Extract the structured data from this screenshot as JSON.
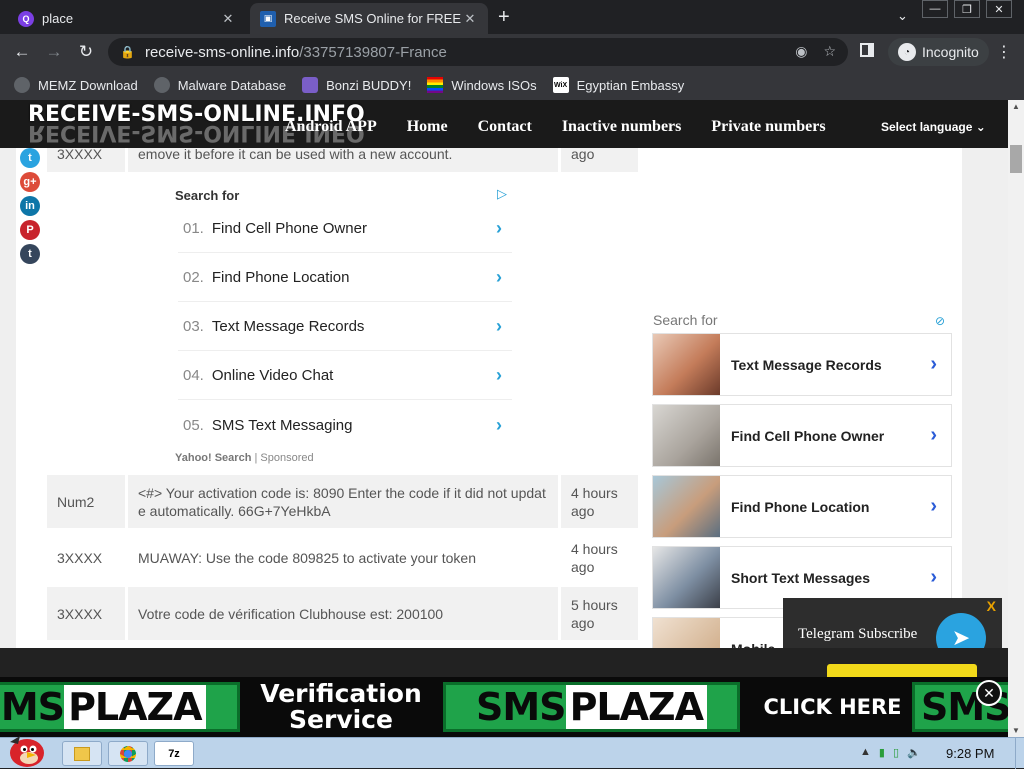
{
  "browser": {
    "tabs": [
      {
        "title": "place",
        "active": false
      },
      {
        "title": "Receive SMS Online for FREE |",
        "active": true
      }
    ],
    "new_tab": "+",
    "url_host": "receive-sms-online.info",
    "url_path": "/33757139807-France",
    "incognito_label": "Incognito",
    "bookmarks": [
      "MEMZ Download",
      "Malware Database",
      "Bonzi BUDDY!",
      "Windows ISOs",
      "Egyptian Embassy"
    ]
  },
  "site": {
    "logo": "RECEIVE-SMS-ONLINE.INFO",
    "nav": [
      "Android APP",
      "Home",
      "Contact",
      "Inactive numbers",
      "Private numbers"
    ],
    "language": "Select language ⌄"
  },
  "messages": {
    "top_row": {
      "from": "3XXXX",
      "text": "emove it before it can be used with a new account.",
      "time": "ago"
    },
    "rows": [
      {
        "from": "Num2",
        "text": "<#> Your activation code is: 8090 Enter the code if it did not updat e automatically. 66G+7YeHkbA",
        "time": "4 hours ago"
      },
      {
        "from": "3XXXX",
        "text": "MUAWAY: Use the code 809825 to activate your token",
        "time": "4 hours ago"
      },
      {
        "from": "3XXXX",
        "text": "Votre code de vérification Clubhouse est: 200100",
        "time": "5 hours ago"
      }
    ]
  },
  "search_ad": {
    "heading": "Search for",
    "items": [
      {
        "n": "01.",
        "label": "Find Cell Phone Owner"
      },
      {
        "n": "02.",
        "label": "Find Phone Location"
      },
      {
        "n": "03.",
        "label": "Text Message Records"
      },
      {
        "n": "04.",
        "label": "Online Video Chat"
      },
      {
        "n": "05.",
        "label": "SMS Text Messaging"
      }
    ],
    "footer_brand": "Yahoo! Search",
    "footer_sep": "|",
    "footer_note": "Sponsored"
  },
  "side_ad": {
    "heading": "Search for",
    "items": [
      "Text Message Records",
      "Find Cell Phone Owner",
      "Find Phone Location",
      "Short Text Messages",
      "Mobile"
    ]
  },
  "telegram": {
    "label": "Telegram Subscribe",
    "close": "X"
  },
  "banner": {
    "brand_a": "SMS",
    "brand_b": "PLAZA",
    "tagline_1": "Verification",
    "tagline_2": "Service",
    "cta": "CLICK HERE",
    "brand_c": "SMS"
  },
  "taskbar": {
    "clock": "9:28 PM",
    "app_label": "7z"
  },
  "colors": {
    "link_blue": "#27a0d6",
    "site_header": "#1a1a1a",
    "banner_green": "#1fa34a",
    "accept_yellow": "#f2d91a"
  }
}
